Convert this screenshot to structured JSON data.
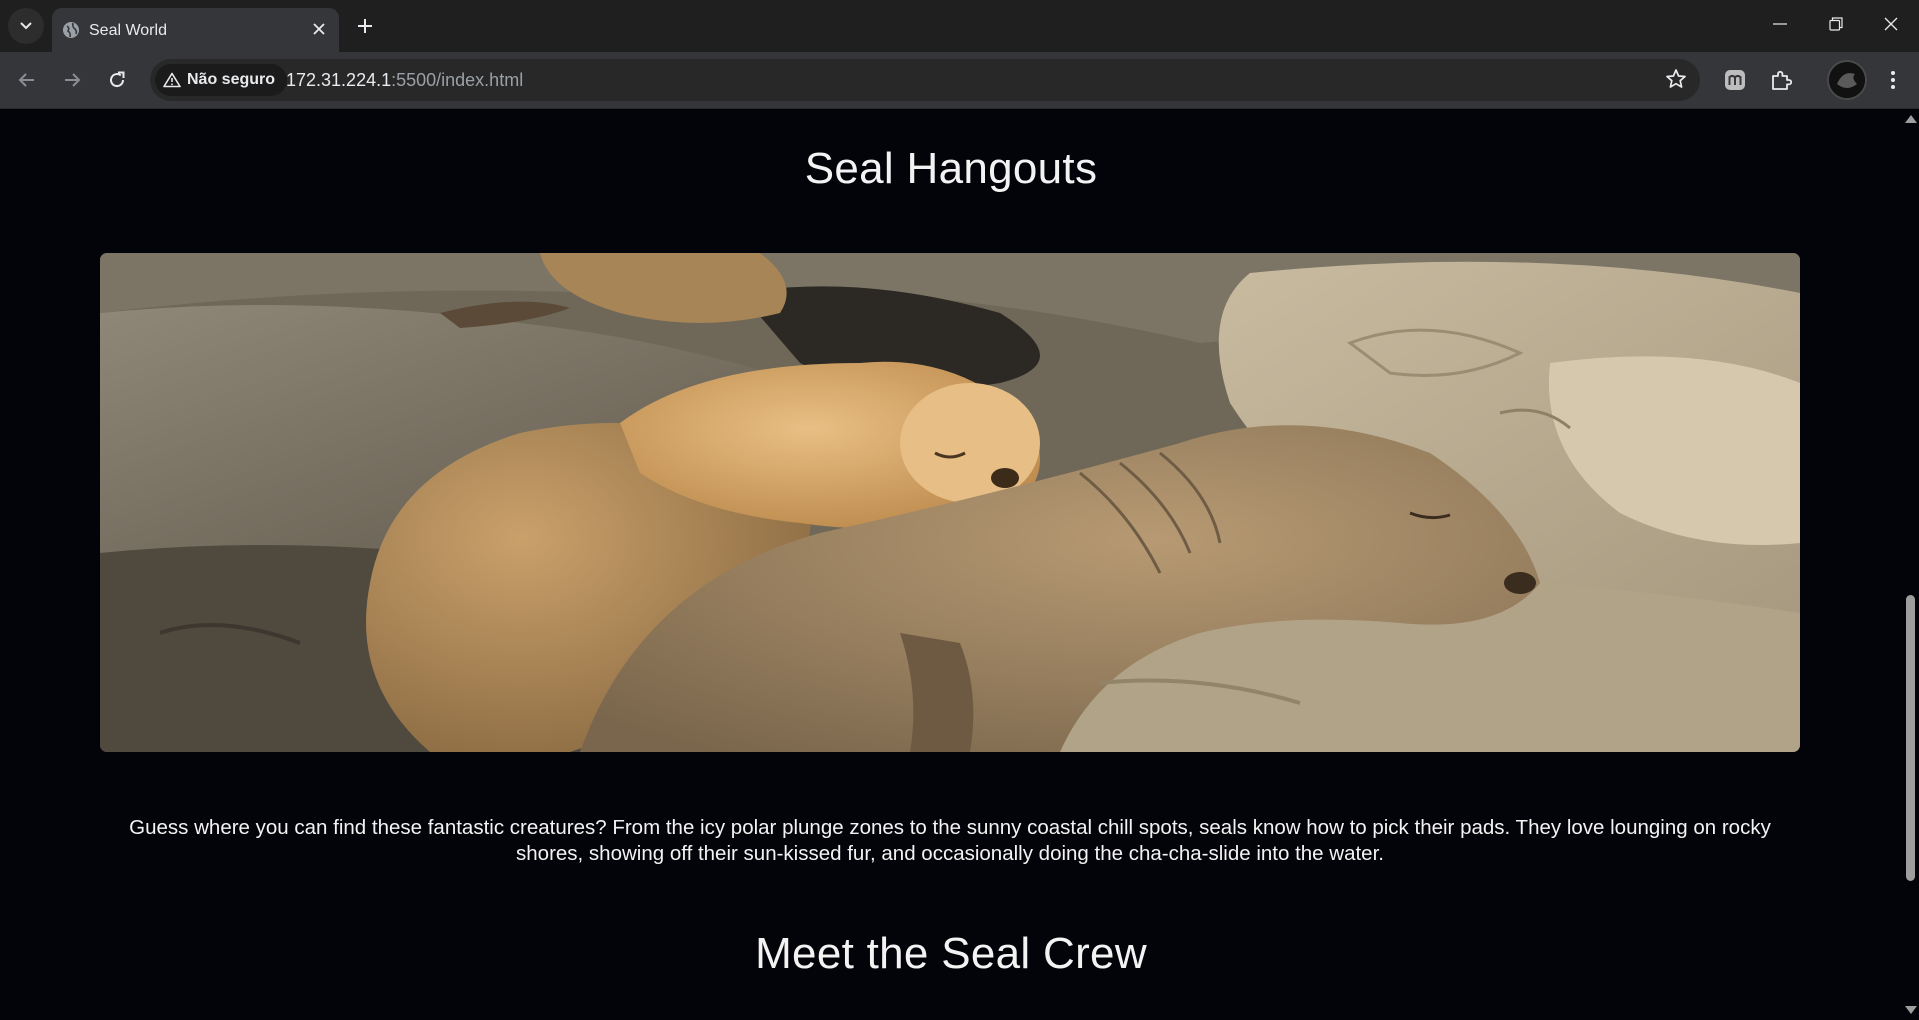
{
  "browser": {
    "tab_title": "Seal World",
    "security_label": "Não seguro",
    "url_host": "172.31.224.1",
    "url_path": ":5500/index.html"
  },
  "page": {
    "section1_title": "Seal Hangouts",
    "description": "Guess where you can find these fantastic creatures? From the icy polar plunge zones to the sunny coastal chill spots, seals know how to pick their pads. They love lounging on rocky shores, showing off their sun-kissed fur, and occasionally doing the cha-cha-slide into the water.",
    "section2_title": "Meet the Seal Crew"
  },
  "colors": {
    "page_background": "#03030a",
    "heading_text": "#f3f3f3",
    "chrome_toolbar": "#35363a",
    "chrome_tabstrip": "#1f1f1f"
  },
  "icons": [
    "tab-search-icon",
    "globe-icon",
    "close-icon",
    "plus-icon",
    "minimize-icon",
    "restore-icon",
    "back-arrow-icon",
    "forward-arrow-icon",
    "reload-icon",
    "warning-icon",
    "star-icon",
    "extension-m-icon",
    "puzzle-icon",
    "kebab-menu-icon"
  ]
}
